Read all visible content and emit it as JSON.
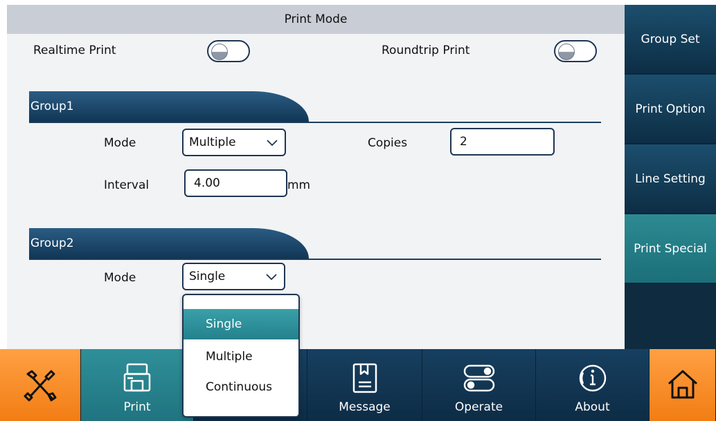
{
  "title": "Print Mode",
  "realtime": {
    "label": "Realtime Print",
    "on": false
  },
  "roundtrip": {
    "label": "Roundtrip Print",
    "on": false
  },
  "group1": {
    "header": "Group1",
    "mode_label": "Mode",
    "mode_value": "Multiple",
    "copies_label": "Copies",
    "copies_value": "2",
    "interval_label": "Interval",
    "interval_value": "4.00",
    "interval_unit": "mm"
  },
  "group2": {
    "header": "Group2",
    "mode_label": "Mode",
    "mode_value": "Single"
  },
  "dropdown": {
    "options": [
      "Single",
      "Multiple",
      "Continuous"
    ],
    "selected": "Single"
  },
  "sidebar": {
    "items": [
      {
        "label": "Group Set"
      },
      {
        "label": "Print Option"
      },
      {
        "label": "Line Setting"
      },
      {
        "label": "Print Special",
        "active": true
      }
    ]
  },
  "bottom": {
    "tabs": [
      {
        "label": "",
        "icon": "tools-icon"
      },
      {
        "label": "Print",
        "icon": "printer-icon",
        "active": true
      },
      {
        "label": "",
        "icon": ""
      },
      {
        "label": "Message",
        "icon": "message-icon"
      },
      {
        "label": "Operate",
        "icon": "operate-icon"
      },
      {
        "label": "About",
        "icon": "info-icon"
      },
      {
        "label": "",
        "icon": "home-icon"
      }
    ]
  },
  "colors": {
    "accent_teal": "#2f8f98",
    "navy": "#113655",
    "orange": "#f27d14"
  }
}
